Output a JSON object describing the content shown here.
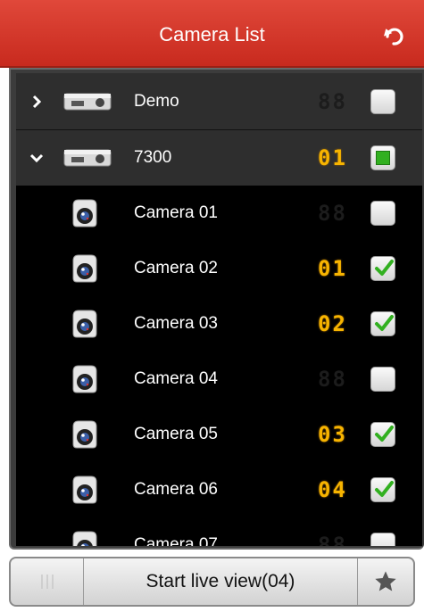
{
  "header": {
    "title": "Camera List",
    "back_icon": "undo-arrow-icon"
  },
  "devices": [
    {
      "name": "Demo",
      "expanded": false,
      "channel": "",
      "selected": false
    },
    {
      "name": "7300",
      "expanded": true,
      "channel": "01",
      "selected": true
    }
  ],
  "cameras": [
    {
      "name": "Camera 01",
      "channel": "",
      "checked": false
    },
    {
      "name": "Camera 02",
      "channel": "01",
      "checked": true
    },
    {
      "name": "Camera 03",
      "channel": "02",
      "checked": true
    },
    {
      "name": "Camera 04",
      "channel": "",
      "checked": false
    },
    {
      "name": "Camera 05",
      "channel": "03",
      "checked": true
    },
    {
      "name": "Camera 06",
      "channel": "04",
      "checked": true
    },
    {
      "name": "Camera 07",
      "channel": "",
      "checked": false
    }
  ],
  "footer": {
    "start_label": "Start live view(04)",
    "handle_icon": "grip-lines-icon",
    "favorite_icon": "star-icon"
  },
  "colors": {
    "header": "#d2362a",
    "digit_on": "#f7b400",
    "check_green": "#32b020"
  }
}
